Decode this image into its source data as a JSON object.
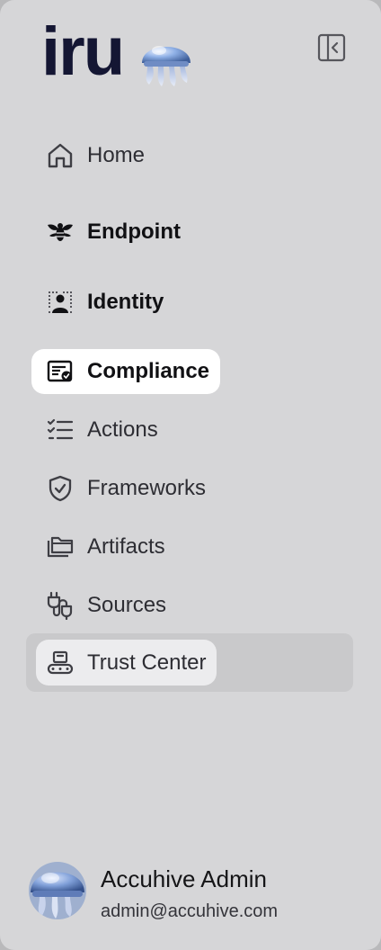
{
  "brand": {
    "logo_text": "iru"
  },
  "nav": {
    "home": "Home",
    "endpoint": "Endpoint",
    "identity": "Identity",
    "compliance": "Compliance",
    "actions": "Actions",
    "frameworks": "Frameworks",
    "artifacts": "Artifacts",
    "sources": "Sources",
    "trust_center": "Trust Center"
  },
  "icons": {
    "collapse": "sidebar-collapse-icon",
    "home": "home-icon",
    "endpoint": "bee-icon",
    "identity": "identity-icon",
    "compliance": "certificate-icon",
    "actions": "checklist-icon",
    "frameworks": "shield-check-icon",
    "artifacts": "folders-icon",
    "sources": "plug-icon",
    "trust_center": "conveyor-icon"
  },
  "user": {
    "name": "Accuhive Admin",
    "email": "admin@accuhive.com"
  },
  "colors": {
    "sidebar_bg": "#d6d6d8",
    "active_item_bg": "#ffffff",
    "trust_band_bg": "#c9c9cb",
    "brand_text": "#141633"
  }
}
